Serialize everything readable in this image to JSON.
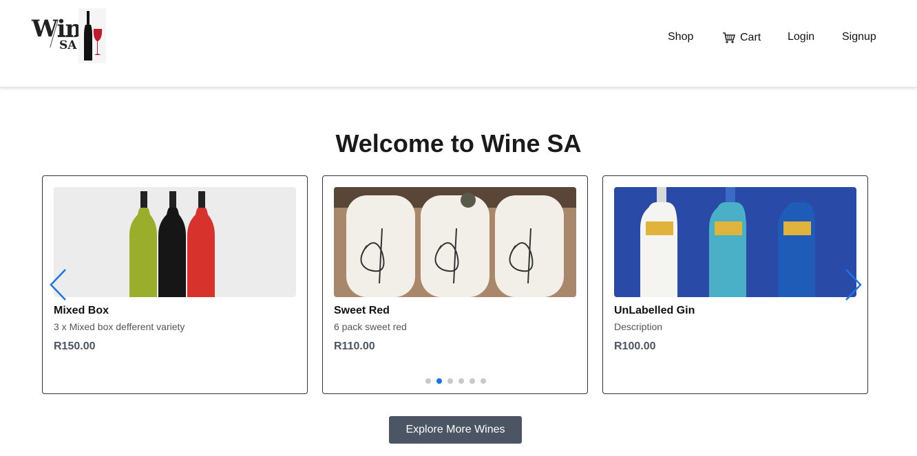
{
  "header": {
    "logo": {
      "word": "Wine",
      "sub": "SA"
    },
    "nav": {
      "shop": "Shop",
      "cart": "Cart",
      "login": "Login",
      "signup": "Signup"
    }
  },
  "main": {
    "title": "Welcome to Wine SA",
    "carousel": {
      "items": [
        {
          "name": "Mixed Box",
          "description": "3 x Mixed box defferent variety",
          "price": "R150.00",
          "image": "three-wine-bottles"
        },
        {
          "name": "Sweet Red",
          "description": "6 pack sweet red",
          "price": "R110.00",
          "image": "morgenster-bottles-in-box"
        },
        {
          "name": "UnLabelled Gin",
          "description": "Description",
          "price": "R100.00",
          "image": "gin-bottles"
        }
      ],
      "dots_total": 6,
      "active_dot": 1,
      "prev_icon": "chevron-left-icon",
      "next_icon": "chevron-right-icon"
    },
    "explore_button": "Explore More Wines"
  },
  "colors": {
    "accent": "#1a73e8",
    "button": "#4b5563",
    "wine_red": "#c0182c"
  }
}
